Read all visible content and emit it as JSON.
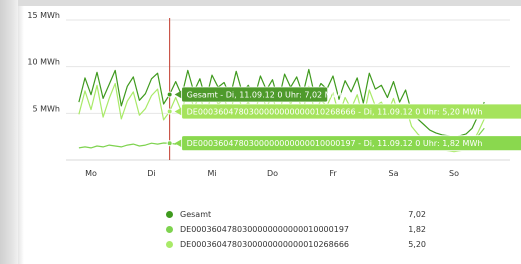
{
  "chart_data": {
    "type": "line",
    "x_labels": [
      "Mo",
      "Di",
      "Mi",
      "Do",
      "Fr",
      "Sa",
      "So"
    ],
    "ylim": [
      0,
      15
    ],
    "yticks": [
      {
        "value": 5,
        "label": "5 MWh"
      },
      {
        "value": 10,
        "label": "10 MWh"
      },
      {
        "value": 15,
        "label": "15 MWh"
      }
    ],
    "grid": true,
    "colors": {
      "gesamt": "#3f9a1e",
      "s197": "#7ed34f",
      "s666": "#a9ea68"
    },
    "series": [
      {
        "name": "Gesamt",
        "legend_value": "7,02",
        "values": [
          6.2,
          8.8,
          7.0,
          9.4,
          6.6,
          8.1,
          9.6,
          5.8,
          7.9,
          8.9,
          6.4,
          7.1,
          8.7,
          9.3,
          6.0,
          7.02,
          8.4,
          6.9,
          9.6,
          7.3,
          8.7,
          6.4,
          9.1,
          7.8,
          8.3,
          6.8,
          9.5,
          7.2,
          8.0,
          6.6,
          9.0,
          7.5,
          8.6,
          6.3,
          9.2,
          7.8,
          8.9,
          7.0,
          9.7,
          6.8,
          8.2,
          7.6,
          9.0,
          6.5,
          8.5,
          7.3,
          8.8,
          6.1,
          9.3,
          7.6,
          8.0,
          6.7,
          8.4,
          6.2,
          7.5,
          5.1,
          4.4,
          3.8,
          3.2,
          2.9,
          2.7,
          2.6,
          2.5,
          2.6,
          2.8,
          3.4,
          4.8,
          6.2
        ]
      },
      {
        "name": "DE0003604780300000000000010000197",
        "legend_value": "1,82",
        "values": [
          1.3,
          1.4,
          1.3,
          1.5,
          1.4,
          1.6,
          1.5,
          1.4,
          1.6,
          1.7,
          1.5,
          1.6,
          1.8,
          1.7,
          1.82,
          1.8,
          1.7,
          1.9,
          1.8,
          1.7,
          1.8,
          1.9,
          1.8,
          1.7,
          1.8,
          1.9,
          1.8,
          1.8,
          1.9,
          1.7,
          1.8,
          1.9,
          1.8,
          1.7,
          1.8,
          1.9,
          1.8,
          1.8,
          1.9,
          1.7,
          1.8,
          1.9,
          1.8,
          1.7,
          1.8,
          1.9,
          1.8,
          1.8,
          1.9,
          1.8,
          1.7,
          1.8,
          1.9,
          1.8,
          1.8,
          1.7,
          1.7,
          1.8,
          1.8,
          1.7,
          1.8,
          1.8,
          1.7,
          1.8,
          1.9,
          2.1,
          2.6,
          3.4
        ]
      },
      {
        "name": "DE0003604780300000000000010268666",
        "legend_value": "5,20",
        "values": [
          4.9,
          7.4,
          5.4,
          8.0,
          4.6,
          6.6,
          8.2,
          4.4,
          6.3,
          7.3,
          4.8,
          5.5,
          6.9,
          7.6,
          4.3,
          5.2,
          6.7,
          5.1,
          7.8,
          5.6,
          6.9,
          4.7,
          7.3,
          6.0,
          6.5,
          5.0,
          7.7,
          5.4,
          6.2,
          4.9,
          7.2,
          5.7,
          6.8,
          4.6,
          7.4,
          6.0,
          7.1,
          5.2,
          7.9,
          5.1,
          6.4,
          5.8,
          7.2,
          4.8,
          6.7,
          5.5,
          7.0,
          4.4,
          7.5,
          5.8,
          6.2,
          5.0,
          6.6,
          4.5,
          5.8,
          3.6,
          2.8,
          2.2,
          1.6,
          1.3,
          1.1,
          1.0,
          0.9,
          1.0,
          1.1,
          1.8,
          3.0,
          4.4
        ]
      }
    ],
    "cursor": {
      "x_label": "Di",
      "index": 15
    },
    "tooltips": [
      {
        "series": 0,
        "text": "Gesamt - Di, 11.09.12 0 Uhr: 7,02 MWh"
      },
      {
        "series": 2,
        "text": "DE0003604780300000000000010268666 - Di, 11.09.12 0 Uhr: 5,20 MWh"
      },
      {
        "series": 1,
        "text": "DE0003604780300000000000010000197 - Di, 11.09.12 0 Uhr: 1,82 MWh"
      }
    ]
  }
}
